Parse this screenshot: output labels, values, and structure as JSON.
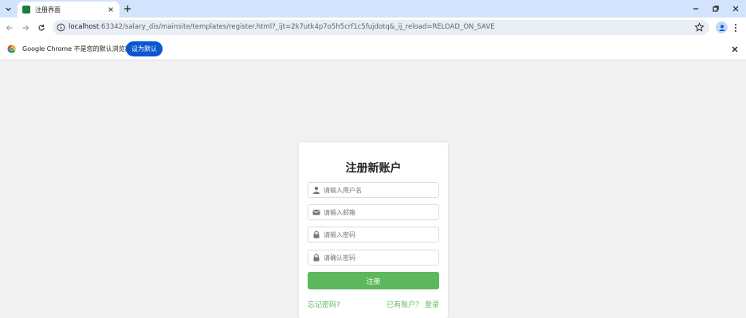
{
  "browser": {
    "tab": {
      "title": "注册界面"
    },
    "address_bar": {
      "host": "localhost",
      "path": ":63342/salary_dis/mainsite/templates/register.html?_ijt=2k7utk4p7o5h5crf1c5fujdotq&_ij_reload=RELOAD_ON_SAVE"
    },
    "infobar": {
      "message": "Google Chrome 不是您的默认浏览器",
      "button_label": "设为默认"
    }
  },
  "icons": {
    "user_field": "user-icon",
    "email_field": "envelope-icon",
    "password_field": "lock-icon",
    "confirm_field": "lock-icon"
  },
  "form": {
    "title": "注册新账户",
    "username": {
      "placeholder": "请输入用户名",
      "value": ""
    },
    "email": {
      "placeholder": "请输入邮箱",
      "value": ""
    },
    "password": {
      "placeholder": "请输入密码",
      "value": ""
    },
    "confirm": {
      "placeholder": "请确认密码",
      "value": ""
    },
    "submit_label": "注册",
    "forgot_link": "忘记密码?",
    "login_link": "已有账户？ 登录"
  },
  "colors": {
    "accent_green": "#5cb85c",
    "chrome_blue": "#0b57d0",
    "tabstrip": "#d3e3fd"
  }
}
